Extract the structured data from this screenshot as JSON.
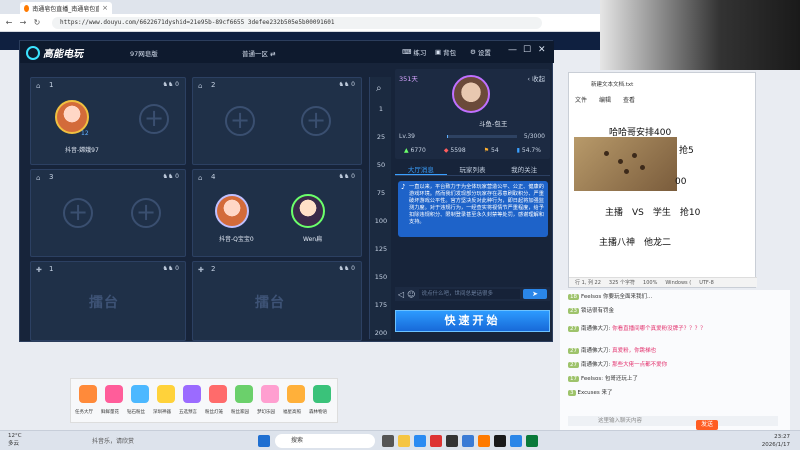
{
  "browser": {
    "tab_title": "南通皂包直播_南通皂包直播_南通",
    "url": "https://www.douyu.com/6622671dyshid=21e95b-89cf6655 3defee232b505e5b00091601"
  },
  "client": {
    "logo": "高能电玩",
    "room_name": "97网皂版",
    "server": "普通一区 ⇄",
    "buttons": {
      "practice": "练习",
      "bag": "背包",
      "settings": "设置"
    },
    "win_controls": {
      "min": "—",
      "max": "☐",
      "close": "✕"
    }
  },
  "seats": [
    {
      "num": "1",
      "count": "0",
      "player": "抖音-嫦娥97",
      "level": "12"
    },
    {
      "num": "2",
      "count": "0"
    },
    {
      "num": "3",
      "count": "0"
    },
    {
      "num": "4",
      "count": "0",
      "player_a": "抖音-Q宝宝0",
      "player_b": "Wen扁"
    },
    {
      "num": "1",
      "count": "0",
      "label": "擂台"
    },
    {
      "num": "2",
      "count": "0",
      "label": "擂台"
    }
  ],
  "scroll_numbers": [
    "1",
    "25",
    "50",
    "75",
    "100",
    "125",
    "150",
    "175",
    "200"
  ],
  "profile": {
    "level_days": "351天",
    "collapse": "‹ 收起",
    "name": "斗鱼-包王",
    "lv": "Lv.39",
    "exp": "5/3000",
    "exp_fraction": 0.0017,
    "stats": [
      "6770",
      "5598",
      "54",
      "54.7%"
    ]
  },
  "tabs": [
    "大厅消息",
    "玩家列表",
    "我的关注"
  ],
  "notice": "一直以来，平台致力于为全体玩家营造公平、公正、健康的游戏环境。然而我们发现部分玩家存在恶意刷取积分、严重破坏游戏公平性。官方坚决反对此种行为，即日起将加强监测力度。对于违规行为，一经查实将视情节严重程度，给予扣除违规积分、限制登录甚至永久封禁等处罚，感谢理解和支持。",
  "chat_placeholder": "说点什么吧，世间总是话很多",
  "quick_start": "快速开始",
  "notepad": {
    "title": "新建文本文档.txt",
    "menu": [
      "文件",
      "编辑",
      "查看"
    ],
    "lines": [
      "哈哈哥安排400",
      "抢5",
      "00",
      "主播　VS　学生　抢10",
      "主播八神　他龙二"
    ],
    "status": [
      "行 1, 列 22",
      "325 个字符",
      "100%",
      "Windows (",
      "UTF-8"
    ]
  },
  "chat": {
    "messages": [
      {
        "user": "Feelsos",
        "text": "你要玩全面来我们..."
      },
      {
        "user": "锁话很有罚金",
        "text": ""
      },
      {
        "user": "南通佛大刀:",
        "text": "你看直播间哪个真爱粉没牌子？？？？",
        "pink": true
      },
      {
        "user": "南通佛大刀:",
        "text": "真爱粉，你跳梯也",
        "pink": true
      },
      {
        "user": "南通佛大刀:",
        "text": "那些大佬一点都不爱你",
        "pink": true
      },
      {
        "user": "Feelsos:",
        "text": "包哥还玩上了"
      },
      {
        "user": "Excuses",
        "text": "来了"
      }
    ],
    "input_placeholder": "这里输入聊天内容",
    "send": "发送"
  },
  "lower_labels": [
    "任务大厅",
    "鲜鲜量花",
    "钻石粉丝",
    "深圳神器",
    "五选预言",
    "粉丝灯笼",
    "粉丝家园",
    "梦幻乐园",
    "福星高照",
    "森林物语"
  ],
  "taskbar": {
    "weather_temp": "12°C",
    "weather_desc": "多云",
    "hint": "抖音乐，请欣赏",
    "search": "搜索",
    "time": "23:27",
    "date": "2026/1/17"
  },
  "colors": {
    "accent": "#2a86e8",
    "client_bg": "#17243a"
  }
}
